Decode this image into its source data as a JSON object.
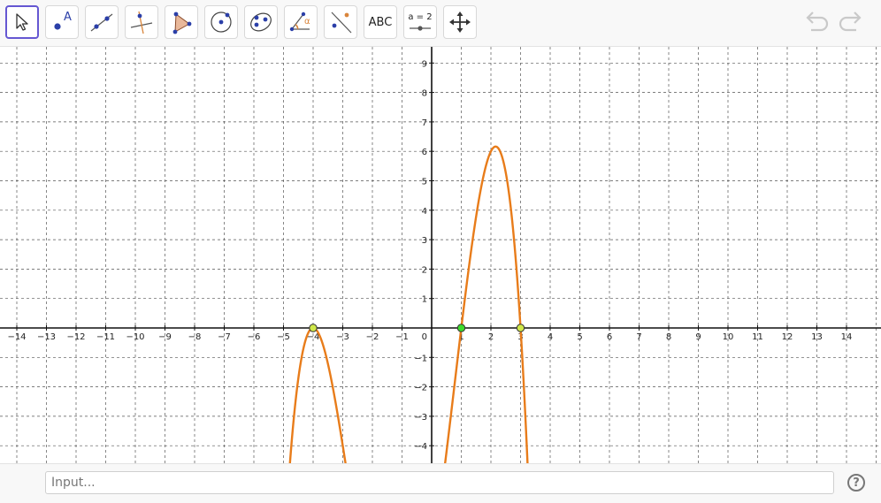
{
  "toolbar": {
    "tools": [
      {
        "id": "move",
        "icon": "cursor-arrow-icon"
      },
      {
        "id": "point",
        "icon": "point-icon",
        "label": "A"
      },
      {
        "id": "line",
        "icon": "line-through-points-icon"
      },
      {
        "id": "perpendicular",
        "icon": "perpendicular-line-icon"
      },
      {
        "id": "polygon",
        "icon": "polygon-icon"
      },
      {
        "id": "circle",
        "icon": "circle-center-point-icon"
      },
      {
        "id": "ellipse",
        "icon": "ellipse-icon"
      },
      {
        "id": "angle",
        "icon": "angle-icon",
        "label": "α"
      },
      {
        "id": "reflect",
        "icon": "reflect-about-line-icon"
      },
      {
        "id": "text",
        "icon": "text-tool-icon",
        "label": "ABC"
      },
      {
        "id": "slider",
        "icon": "slider-icon",
        "label": "a = 2"
      },
      {
        "id": "move-graphics",
        "icon": "move-graphics-view-icon"
      }
    ],
    "undo_icon": "undo-icon",
    "redo_icon": "redo-icon",
    "colors": {
      "active_border": "#6557d2",
      "tool_blue": "#2b3fa8",
      "tool_orange": "#d9853b"
    }
  },
  "graph": {
    "xlim": [
      -15,
      15.5
    ],
    "ylim": [
      -4.5,
      9.6
    ],
    "x_ticks": [
      -14,
      -13,
      -12,
      -11,
      -10,
      -9,
      -8,
      -7,
      -6,
      -5,
      -4,
      -3,
      -2,
      -1,
      1,
      2,
      3,
      4,
      5,
      6,
      7,
      8,
      9,
      10,
      11,
      12,
      13,
      14
    ],
    "y_ticks": [
      -4,
      -3,
      -2,
      -1,
      1,
      2,
      3,
      4,
      5,
      6,
      7,
      8,
      9
    ],
    "origin_label": "0",
    "grid": "dashed",
    "curve_color": "#e87c1a",
    "curve_type": "quartic",
    "roots": [
      -4,
      1,
      3
    ],
    "local_max": [
      2,
      6
    ],
    "points": [
      {
        "x": -4,
        "y": 0,
        "color": "#cfe84a"
      },
      {
        "x": 1,
        "y": 0,
        "color": "#3ddc2b"
      },
      {
        "x": 3,
        "y": 0,
        "color": "#cfe84a"
      }
    ]
  },
  "input_bar": {
    "placeholder": "Input...",
    "help_label": "?"
  }
}
